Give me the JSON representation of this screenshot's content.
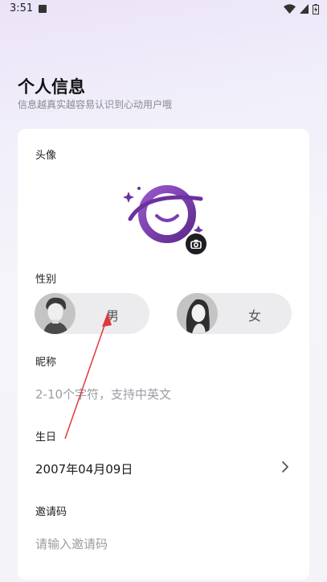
{
  "status_bar": {
    "time": "3:51",
    "icons": [
      "notification-app-icon",
      "wifi-icon",
      "cell-signal-icon",
      "battery-charging-icon"
    ]
  },
  "header": {
    "title": "个人信息",
    "subtitle": "信息越真实越容易认识到心动用户哦"
  },
  "form": {
    "avatar_label": "头像",
    "gender_label": "性别",
    "gender_options": [
      "男",
      "女"
    ],
    "nickname_label": "昵称",
    "nickname_placeholder": "2-10个字符，支持中英文",
    "birthday_label": "生日",
    "birthday_value": "2007年04月09日",
    "invite_label": "邀请码",
    "invite_placeholder": "请输入邀请码"
  },
  "colors": {
    "accent_purple": "#7b3fb0",
    "annotation_red": "#e0383e"
  }
}
